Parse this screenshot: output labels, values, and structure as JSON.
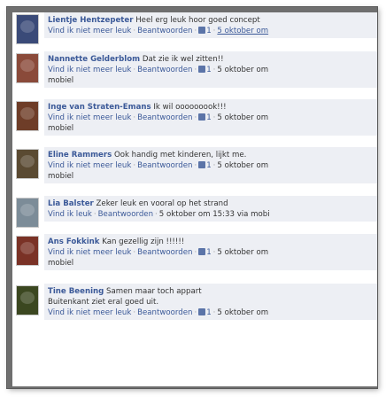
{
  "comments": [
    {
      "author": "Lientje Hentzepeter",
      "text": "Heel erg leuk hoor goed concept",
      "unlike": "Vind ik niet meer leuk",
      "reply": "Beantwoorden",
      "likes": "1",
      "date": "5 oktober om",
      "avatar_color": "#3a4a78"
    },
    {
      "author": "Nannette Gelderblom",
      "text": "Dat zie ik wel zitten!!",
      "unlike": "Vind ik niet meer leuk",
      "reply": "Beantwoorden",
      "likes": "1",
      "date": "5 oktober om",
      "extra": "mobiel",
      "avatar_color": "#8a4a3a"
    },
    {
      "author": "Inge van Straten-Emans",
      "text": "Ik wil ooooooook!!!",
      "unlike": "Vind ik niet meer leuk",
      "reply": "Beantwoorden",
      "likes": "1",
      "date": "5 oktober om",
      "extra": "mobiel",
      "avatar_color": "#6e3d28"
    },
    {
      "author": "Eline Rammers",
      "text": "Ook handig met kinderen, lijkt me.",
      "unlike": "Vind ik niet meer leuk",
      "reply": "Beantwoorden",
      "likes": "1",
      "date": "5 oktober om",
      "extra": "mobiel",
      "avatar_color": "#5a4a32"
    },
    {
      "author": "Lia Balster",
      "text": "Zeker leuk en vooral op het strand",
      "like": "Vind ik leuk",
      "reply": "Beantwoorden",
      "date": "5 oktober om 15:33 via mobi",
      "avatar_color": "#7c8c98"
    },
    {
      "author": "Ans Fokkink",
      "text": "Kan gezellig zijn !!!!!!",
      "unlike": "Vind ik niet meer leuk",
      "reply": "Beantwoorden",
      "likes": "1",
      "date": "5 oktober om",
      "extra": "mobiel",
      "avatar_color": "#7a3226"
    },
    {
      "author": "Tine Beening",
      "text": "Samen maar toch appart",
      "line2": "Buitenkant ziet eral goed uit.",
      "unlike": "Vind ik niet meer leuk",
      "reply": "Beantwoorden",
      "likes": "1",
      "date": "5 oktober om",
      "avatar_color": "#3b4720"
    }
  ]
}
